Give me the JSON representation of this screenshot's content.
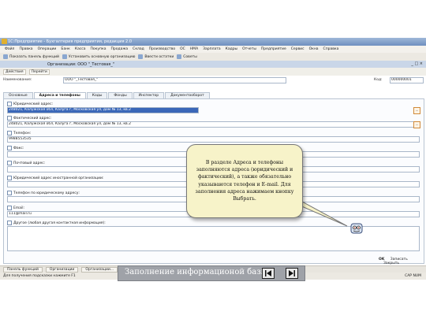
{
  "window": {
    "title": "1С:Предприятие - Бухгалтерия предприятия, редакция 2.0"
  },
  "menu": [
    "Файл",
    "Правка",
    "Операции",
    "Банк",
    "Касса",
    "Покупка",
    "Продажа",
    "Склад",
    "Производство",
    "ОС",
    "НМА",
    "Зарплата",
    "Кадры",
    "Отчеты",
    "Предприятие",
    "Сервис",
    "Окна",
    "Справка"
  ],
  "toolbar": {
    "items": [
      "Показать панель функций",
      "Установить основную организацию",
      "Ввести остатки",
      "Советы"
    ]
  },
  "document": {
    "title": "Организации: ООО \"_Тестовая_\"",
    "actions": [
      "Действия",
      "Перейти"
    ],
    "name_label": "Наименование:",
    "name_value": "ООО \"_Тестовая_\"",
    "code_label": "Код:",
    "code_value": "000000001"
  },
  "tabs": [
    "Основные",
    "Адреса и телефоны",
    "Коды",
    "Фонды",
    "Инспектор",
    "Документооборот"
  ],
  "sections": [
    {
      "label": "Юридический адрес:",
      "value": "248021, Калужская обл, Калуга г, Московская ул, дом № 13, кв.2",
      "selected": true
    },
    {
      "label": "Фактический адрес:",
      "value": "248021, Калужская обл, Калуга г, Московская ул, дом № 13, кв.2",
      "selected": false
    },
    {
      "label": "Телефон:",
      "value": "9988553535",
      "selected": false
    },
    {
      "label": "Факс:",
      "value": "",
      "selected": false
    },
    {
      "label": "Почтовый адрес:",
      "value": "",
      "selected": false
    },
    {
      "label": "Юридический адрес иностранной организации:",
      "value": "",
      "selected": false
    },
    {
      "label": "Телефон по юридическому адресу:",
      "value": "",
      "selected": false
    },
    {
      "label": "Email:",
      "value": "111@mail.ru",
      "selected": false
    },
    {
      "label": "Другое (любая другая контактная информация):",
      "value": "",
      "selected": false
    }
  ],
  "bottom_actions": {
    "ok": "OK",
    "save": "Записать",
    "close": "Закрыть"
  },
  "taskbar": [
    "Панель функций",
    "Организации",
    "Организации..."
  ],
  "statusbar": {
    "hint": "Для получения подсказки нажмите F1",
    "caps": "CAP NUM"
  },
  "callout": {
    "text": "В разделе Адреса и телефоны заполняются адреса (юридический и фактический), а также обязательно указываются телефон и E-mail. Для заполнения адреса нажимаем кнопку Выбрать."
  },
  "slide_nav": {
    "title": "Заполнение информационой базы"
  }
}
